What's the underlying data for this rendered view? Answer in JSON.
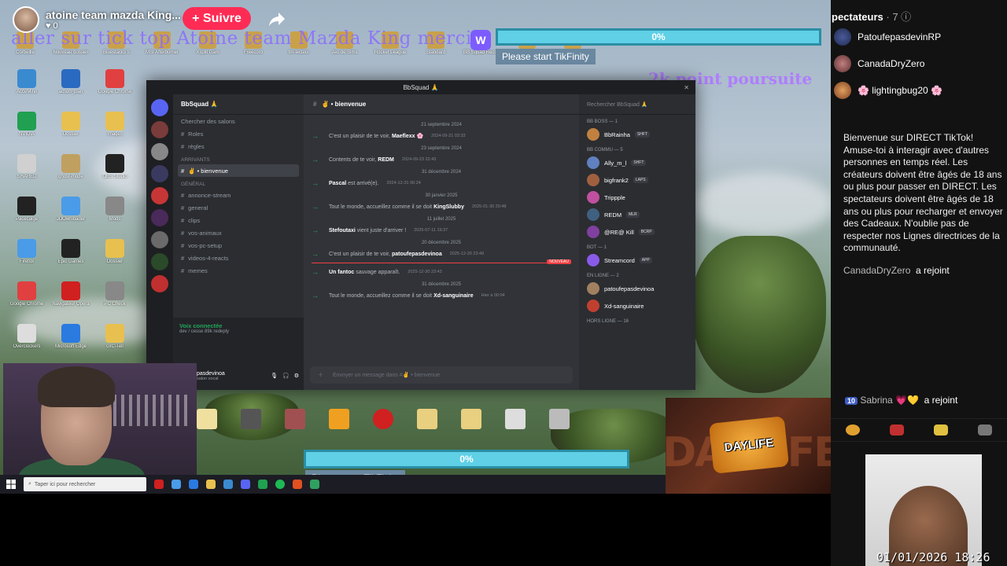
{
  "stream": {
    "streamer_name": "atoine team mazda King...",
    "likes": "0",
    "follow_label": "+ Suivre",
    "overlay_text": "aller sur tick top Atoine team Mazda King merci",
    "goal_text": "2k point poursuite",
    "progress_top": "0%",
    "progress_bottom": "0%",
    "tikfinity_prompt": "Please start TikFinity",
    "datetime": "01/01/2026  18:26"
  },
  "desktop": {
    "top_icons": [
      "Corbeille",
      "Nouveau dossier",
      "Bluestacks 5",
      "MSI Afterburner",
      "Xsplit Gam",
      "Freecord",
      "tm-lecteur",
      "Jeu de Sims",
      "Rocket League",
      "Standard",
      "BB Squad Recon",
      "Spotify",
      "NordVPN"
    ],
    "left_icons": [
      "AcceMinit",
      "action_plan",
      "Google Chrome",
      "NVIDIA",
      "Dossier",
      "Images",
      "SHARED",
      "ghost-mode",
      "OBS Studio",
      "Pacecalge",
      "JDOwnloader",
      "Mods",
      "Firefox",
      "Epic Games",
      "Dossier",
      "Google Chrome",
      "Navigateur Opera",
      "PC Check",
      "Overclockers",
      "Microsoft Edge",
      "GIC-Tell"
    ]
  },
  "discord": {
    "window_title": "BbSquad 🙏",
    "guild_name": "BbSquad 🙏",
    "search_servers": "Chercher des salons",
    "channels": [
      {
        "type": "label",
        "text": "Roles"
      },
      {
        "type": "ch",
        "text": "règles"
      },
      {
        "type": "cat",
        "text": "Arrivants"
      },
      {
        "type": "ch",
        "text": "✌ • bienvenue",
        "active": true
      },
      {
        "type": "cat",
        "text": "Général"
      },
      {
        "type": "ch",
        "text": "annonce-stream"
      },
      {
        "type": "ch",
        "text": "general"
      },
      {
        "type": "ch",
        "text": "clips"
      },
      {
        "type": "ch",
        "text": "vos-animaux"
      },
      {
        "type": "ch",
        "text": "vos-pc-setup"
      },
      {
        "type": "ch",
        "text": "videos-4-reacts"
      },
      {
        "type": "ch",
        "text": "memes"
      }
    ],
    "voice_status": "Voix connectée",
    "voice_sub": "dev / cesse 89k redeply",
    "user_name": "pasdevinoa",
    "user_status": "salon vocal",
    "channel_header": "✌ • bienvenue",
    "search_label": "Rechercher BbSquad 🙏",
    "messages": [
      {
        "date": "21 septembre 2024",
        "text": "C'est un plaisir de te voir,",
        "user": "Maeflexx 🌸",
        "ts": "2024-09-21 03:33"
      },
      {
        "date": "23 septembre 2024",
        "text": "Contents de te voir,",
        "user": "REDM",
        "ts": "2024-09-23 22:43"
      },
      {
        "date": "31 décembre 2024",
        "text": "est arrivé(e).",
        "user": "Pascal",
        "ts": "2024-12-31 06:24",
        "user_first": true
      },
      {
        "date": "30 janvier 2025",
        "text": "Tout le monde, accueillez comme il se doit",
        "user": "KingSlubby",
        "ts": "2025-01-30 20:48"
      },
      {
        "date": "11 juillet 2025",
        "text": "vient juste d'arriver !",
        "user": "Stefoutaxi",
        "ts": "2025-07-11 19:37",
        "user_first": true
      },
      {
        "date": "20 décembre 2025",
        "text": "C'est un plaisir de te voir,",
        "user": "patoufepasdevinoa",
        "ts": "2025-12-20 23:49"
      },
      {
        "date": "",
        "text": "sauvage apparaît.",
        "user": "Un fantoc",
        "ts": "2025-12-30 23:43",
        "user_first": true
      },
      {
        "date": "31 décembre 2025",
        "text": "Tout le monde, accueillez comme il se doit",
        "user": "Xd-sanguinaire",
        "ts": "Hier à 00:04"
      }
    ],
    "new_label": "NOUVEAU",
    "input_placeholder": "Envoyer un message dans #✌ • bienvenue",
    "member_groups": [
      {
        "title": "BB BOSS — 1",
        "members": [
          {
            "name": "BbRainha",
            "badge": "SHFT"
          }
        ]
      },
      {
        "title": "BB COMMU — 5",
        "members": [
          {
            "name": "Ally_m_l",
            "badge": "SHFT"
          },
          {
            "name": "bigfrank2",
            "badge": "LAPS"
          },
          {
            "name": "Trippple",
            "badge": ""
          },
          {
            "name": "REDM",
            "badge": "MLR"
          },
          {
            "name": "@RE@ Kill",
            "badge": "BCRP"
          }
        ]
      },
      {
        "title": "BOT — 1",
        "members": [
          {
            "name": "Streamcord",
            "badge": "APP"
          }
        ]
      },
      {
        "title": "En ligne — 2",
        "members": [
          {
            "name": "patoufepasdevinoa",
            "badge": ""
          },
          {
            "name": "Xd-sanguinaire",
            "badge": ""
          }
        ]
      },
      {
        "title": "Hors ligne — 16",
        "members": []
      }
    ]
  },
  "taskbar": {
    "search_placeholder": "Taper ici pour rechercher"
  },
  "daylife": {
    "logo": "DAYLIFE",
    "bg_text": "DAYLIFE"
  },
  "panel": {
    "spectators_label": "pectateurs",
    "spectators_count": "· 7",
    "viewers": [
      {
        "name": "PatoufepasdevinRP"
      },
      {
        "name": "CanadaDryZero"
      },
      {
        "name": "🌸 lightingbug20 🌸"
      }
    ],
    "welcome_message": "Bienvenue sur DIRECT TikTok! Amuse-toi à interagir avec d'autres personnes en temps réel. Les créateurs doivent être âgés de 18 ans ou plus pour passer en DIRECT. Les spectateurs doivent être âgés de 18 ans ou plus pour recharger et envoyer des Cadeaux. N'oublie pas de respecter nos Lignes directrices de la communauté.",
    "join1_name": "CanadaDryZero",
    "join1_action": "a rejoint",
    "join2_level": "10",
    "join2_name": "Sabrina 💗💛",
    "join2_action": "a rejoint"
  },
  "colors": {
    "follow": "#fe2c55",
    "progress": "#5fd0e6",
    "discord_bg": "#313338",
    "panel_bg": "#121212",
    "overlay_text": "#8a6cff"
  }
}
